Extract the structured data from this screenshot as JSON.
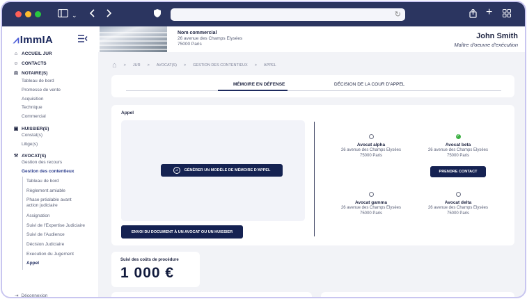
{
  "app": {
    "logo": "ImmIA"
  },
  "sidebar": {
    "sections": [
      {
        "label": "ACCUEIL JUR",
        "icon": "home-icon"
      },
      {
        "label": "CONTACTS",
        "icon": "user-icon"
      },
      {
        "label": "NOTAIRE(S)",
        "icon": "scale-icon",
        "items": [
          "Tableau de bord",
          "Promesse de vente",
          "Acquisition",
          "Technique",
          "Commercial"
        ]
      },
      {
        "label": "HUISSIER(S)",
        "icon": "briefcase-icon",
        "items": [
          "Constat(s)",
          "Litige(s)"
        ]
      },
      {
        "label": "AVOCAT(S)",
        "icon": "gavel-icon",
        "items": [
          "Gestion des recours",
          "Gestion des contentieux"
        ]
      }
    ],
    "contentieux_items": [
      "Tableau de bord",
      "Règlement amiable",
      "Phase préalable avant action judiciaire",
      "Assignation",
      "Suivi de l'Expertise Judiciaire",
      "Suivi de l'Audience",
      "Décision Judiciaire",
      "Execution du Jugement",
      "Appel"
    ],
    "logout": "Déconnexion"
  },
  "header": {
    "property_title": "Nom commercial",
    "address_line1": "26 avenue des Champs Elysées",
    "address_line2": "75000 Paris",
    "user_name": "John Smith",
    "user_role": "Maître d'oeuvre d'exécution"
  },
  "breadcrumb": [
    "JUR",
    "AVOCAT(S)",
    "GESTION DES CONTENTIEUX",
    "APPEL"
  ],
  "tabs": [
    "MÉMOIRE EN DÉFENSE",
    "DÉCISION DE LA COUR D'APPEL"
  ],
  "appel": {
    "title": "Appel",
    "generate_button": "GÉNÉRER UN MODÈLE DE MÉMOIRE D'APPEL",
    "send_button": "ENVOI DU DOCUMENT À UN AVOCAT OU UN HUISSIER",
    "contact_button": "PRENDRE CONTACT",
    "lawyers": [
      {
        "name": "Avocat alpha",
        "address1": "26 avenue des Champs Elysées",
        "address2": "75000 Paris",
        "selected": false
      },
      {
        "name": "Avocat beta",
        "address1": "26 avenue des Champs Elysées",
        "address2": "75000 Paris",
        "selected": true
      },
      {
        "name": "Avocat gamma",
        "address1": "26 avenue des Champs Elysées",
        "address2": "75000 Paris",
        "selected": false
      },
      {
        "name": "Avocat delta",
        "address1": "26 avenue des Champs Elysées",
        "address2": "75000 Paris",
        "selected": false
      }
    ]
  },
  "couts": {
    "title": "Suivi des coûts de procédure",
    "value": "1 000 €"
  }
}
